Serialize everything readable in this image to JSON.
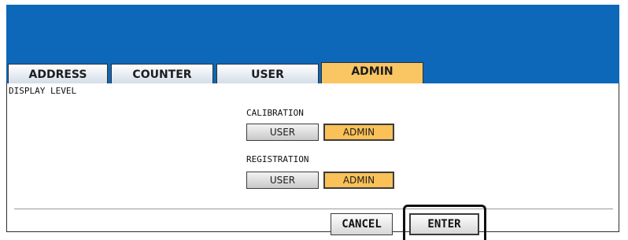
{
  "tabs": [
    {
      "label": "ADDRESS",
      "active": false
    },
    {
      "label": "COUNTER",
      "active": false
    },
    {
      "label": "USER",
      "active": false
    },
    {
      "label": "ADMIN",
      "active": true
    }
  ],
  "page": {
    "title": "DISPLAY LEVEL"
  },
  "calibration": {
    "label": "CALIBRATION",
    "options": [
      "USER",
      "ADMIN"
    ],
    "selected": "ADMIN"
  },
  "registration": {
    "label": "REGISTRATION",
    "options": [
      "USER",
      "ADMIN"
    ],
    "selected": "ADMIN"
  },
  "actions": {
    "cancel_label": "CANCEL",
    "enter_label": "ENTER"
  },
  "colors": {
    "header_blue": "#0d68b9",
    "active_orange": "#f9c158"
  }
}
